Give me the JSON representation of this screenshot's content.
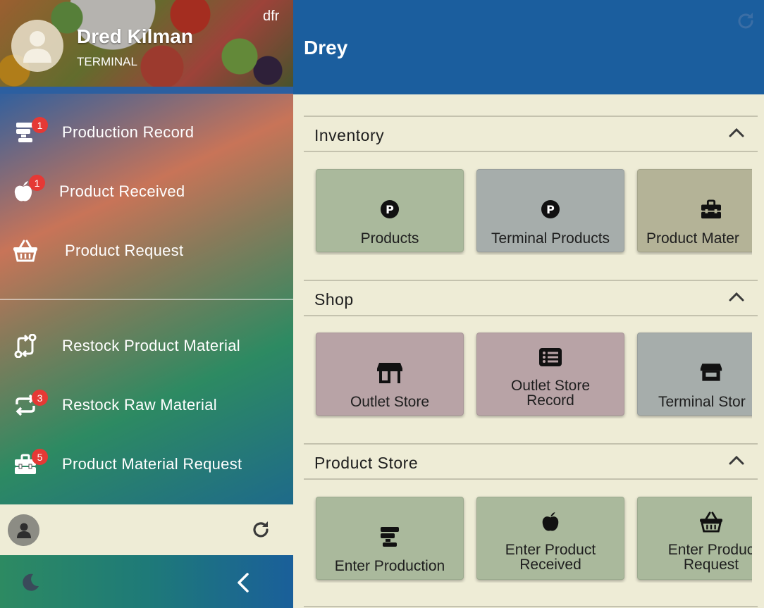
{
  "user": {
    "name": "Dred Kilman",
    "role": "TERMINAL",
    "tag": "dfr"
  },
  "header": {
    "title": "Drey"
  },
  "sidebar": {
    "items": [
      {
        "label": "Production Record",
        "icon": "production-icon",
        "badge": "1"
      },
      {
        "label": "Product Received",
        "icon": "apple-icon",
        "badge": "1"
      },
      {
        "label": "Product Request",
        "icon": "basket-icon",
        "badge": ""
      },
      {
        "label": "Restock Product Material",
        "icon": "restock-product-icon",
        "badge": ""
      },
      {
        "label": "Restock Raw Material",
        "icon": "restock-raw-icon",
        "badge": "3"
      },
      {
        "label": "Product Material Request",
        "icon": "toolbox-icon",
        "badge": "5"
      }
    ]
  },
  "sections": [
    {
      "title": "Inventory",
      "tiles": [
        {
          "label": "Products",
          "icon": "p-circle-icon",
          "color": "#aab99c"
        },
        {
          "label": "Terminal Products",
          "icon": "p-circle-icon",
          "color": "#a6adab"
        },
        {
          "label": "Product Mater",
          "icon": "toolbox-icon",
          "color": "#b4b397"
        }
      ]
    },
    {
      "title": "Shop",
      "tiles": [
        {
          "label": "Outlet Store",
          "icon": "store-icon",
          "color": "#b8a3a6"
        },
        {
          "label": "Outlet Store\nRecord",
          "icon": "list-icon",
          "color": "#b8a3a6"
        },
        {
          "label": "Terminal Stor",
          "icon": "store-icon",
          "color": "#a6adab"
        }
      ]
    },
    {
      "title": "Product Store",
      "tiles": [
        {
          "label": "Enter Production",
          "icon": "production-icon",
          "color": "#aab99c"
        },
        {
          "label": "Enter Product\nReceived",
          "icon": "apple-icon",
          "color": "#aab99c"
        },
        {
          "label": "Enter Produc\nRequest",
          "icon": "basket-icon",
          "color": "#aab99c"
        }
      ]
    }
  ],
  "colors": {
    "topbar": "#1b5e9e",
    "badge": "#e53935",
    "background": "#eeecd6"
  }
}
